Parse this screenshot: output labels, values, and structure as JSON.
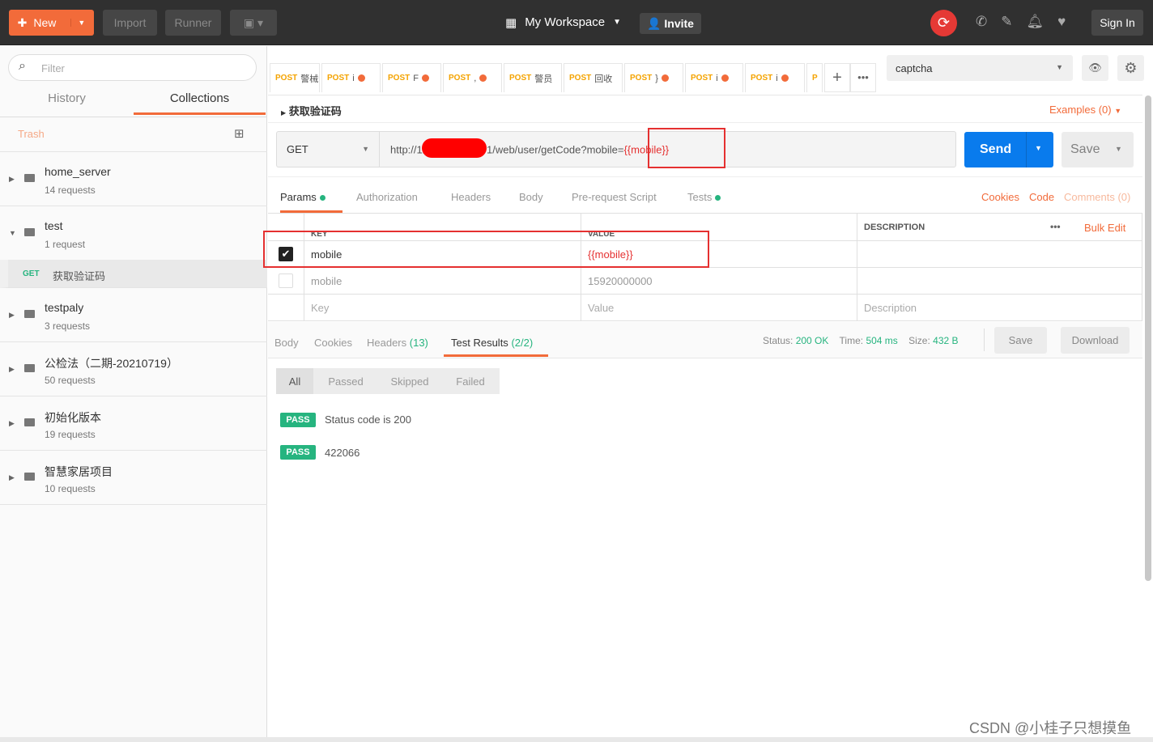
{
  "topbar": {
    "new": "New",
    "import": "Import",
    "runner": "Runner",
    "workspace": "My Workspace",
    "invite": "Invite",
    "sign_in": "Sign In"
  },
  "sidebar": {
    "filter_placeholder": "Filter",
    "tabs": [
      "History",
      "Collections"
    ],
    "trash": "Trash",
    "collections": [
      {
        "name": "home_server",
        "count": "14 requests"
      },
      {
        "name": "test",
        "count": "1 request",
        "expanded": true
      },
      {
        "name": "testpaly",
        "count": "3 requests"
      },
      {
        "name": "公检法（二期-20210719）",
        "count": "50 requests"
      },
      {
        "name": "初始化版本",
        "count": "19 requests"
      },
      {
        "name": "智慧家居项目",
        "count": "10 requests"
      }
    ],
    "request": {
      "method": "GET",
      "name": "获取验证码"
    }
  },
  "tabs": [
    {
      "m": "POST",
      "t": "警械"
    },
    {
      "m": "POST",
      "t": "i",
      "dot": true
    },
    {
      "m": "POST",
      "t": "F",
      "dot": true
    },
    {
      "m": "POST",
      "t": ",",
      "dot": true
    },
    {
      "m": "POST",
      "t": "警员"
    },
    {
      "m": "POST",
      "t": "回收"
    },
    {
      "m": "POST",
      "t": "}",
      "dot": true
    },
    {
      "m": "POST",
      "t": "i",
      "dot": true
    },
    {
      "m": "POST",
      "t": "i",
      "dot": true
    },
    {
      "m": "P",
      "t": ""
    }
  ],
  "environment": "captcha",
  "request": {
    "name": "获取验证码",
    "examples": "Examples (0)",
    "method": "GET",
    "url_prefix": "http://12",
    "url_suffix": "1/web/user/getCode?mobile=",
    "url_var": "{{mobile}}",
    "send": "Send",
    "save": "Save"
  },
  "param_tabs": [
    "Params",
    "Authorization",
    "Headers",
    "Body",
    "Pre-request Script",
    "Tests"
  ],
  "right_links": {
    "cookies": "Cookies",
    "code": "Code",
    "comments": "Comments (0)"
  },
  "params": {
    "headers": [
      "KEY",
      "VALUE",
      "DESCRIPTION"
    ],
    "bulk_edit": "Bulk Edit",
    "rows": [
      {
        "key": "mobile",
        "value": "{{mobile}}",
        "checked": true
      },
      {
        "key": "mobile",
        "value": "15920000000",
        "checked": false
      }
    ],
    "placeholders": {
      "key": "Key",
      "value": "Value",
      "description": "Description"
    }
  },
  "response": {
    "tabs": [
      "Body",
      "Cookies",
      "Headers",
      "Test Results"
    ],
    "headers_count": "(13)",
    "tests_count": "(2/2)",
    "status_label": "Status:",
    "status": "200 OK",
    "time_label": "Time:",
    "time": "504 ms",
    "size_label": "Size:",
    "size": "432 B",
    "save": "Save",
    "download": "Download",
    "filters": [
      "All",
      "Passed",
      "Skipped",
      "Failed"
    ],
    "results": [
      {
        "badge": "PASS",
        "text": "Status code is 200"
      },
      {
        "badge": "PASS",
        "text": "422066"
      }
    ]
  },
  "watermark": "CSDN @小桂子只想摸鱼",
  "colors": {
    "accent": "#f26b3a",
    "send": "#097bed",
    "pass": "#26b47f",
    "annotation": "#e53030"
  }
}
